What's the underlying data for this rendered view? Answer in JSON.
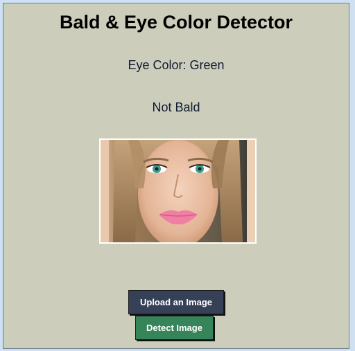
{
  "app": {
    "title": "Bald & Eye Color Detector"
  },
  "results": {
    "eye_color": "Eye Color: Green",
    "bald_status": "Not Bald"
  },
  "buttons": {
    "upload_label": "Upload an Image",
    "detect_label": "Detect Image"
  },
  "colors": {
    "background": "#cccdbb",
    "upload_button": "#364158",
    "detect_button": "#36845a"
  }
}
